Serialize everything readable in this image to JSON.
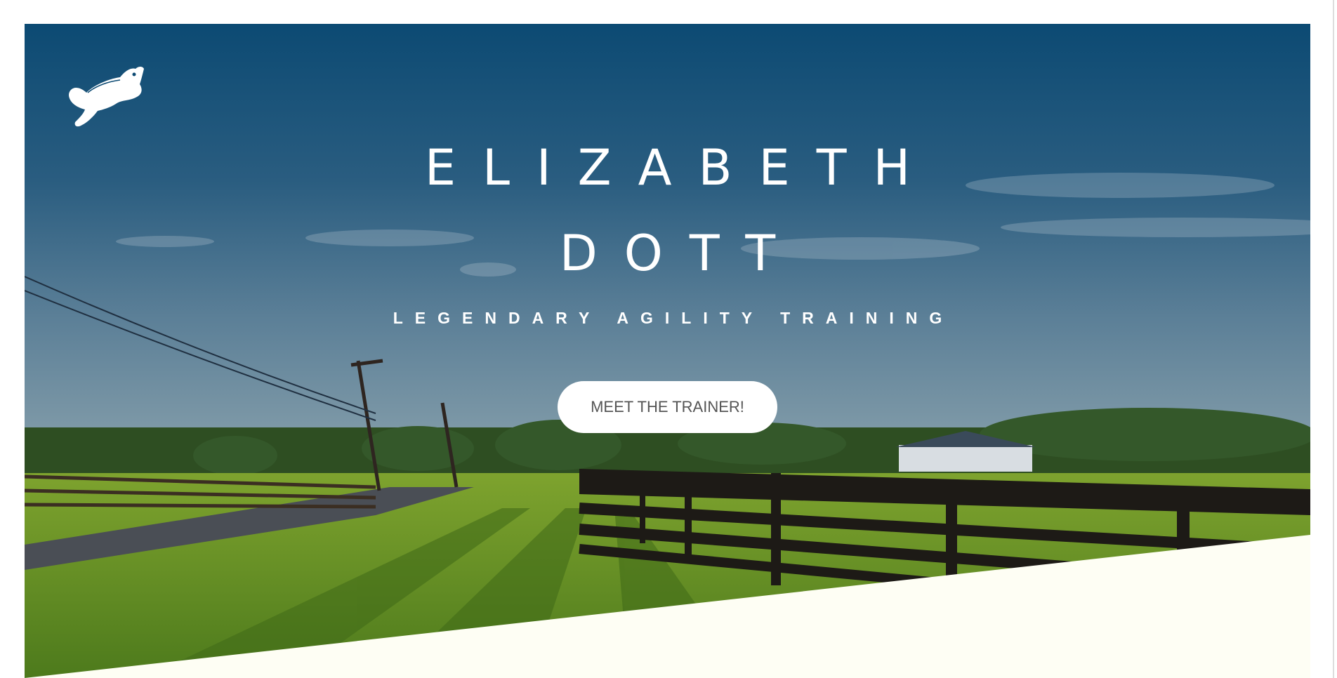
{
  "hero": {
    "title_line1": "ELIZABETH",
    "title_line2": "DOTT",
    "tagline": "LEGENDARY AGILITY TRAINING",
    "cta_label": "MEET THE TRAINER!"
  },
  "logo": {
    "icon": "leaping-dog-icon"
  },
  "colors": {
    "sky_top": "#0c4a73",
    "sky_horizon": "#6f8fa3",
    "grass": "#6f9a2a",
    "fence": "#1d1a16",
    "section_bg": "#fefef4",
    "button_bg": "#ffffff",
    "button_text": "#555555"
  }
}
